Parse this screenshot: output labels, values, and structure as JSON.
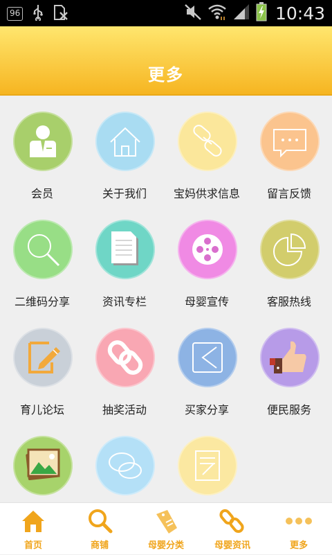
{
  "status_bar": {
    "badge": "96",
    "time": "10:43"
  },
  "header": {
    "title": "更多"
  },
  "grid": {
    "items": [
      {
        "label": "会员",
        "icon": "member-icon",
        "color": "#a8cf6b"
      },
      {
        "label": "关于我们",
        "icon": "home-icon",
        "color": "#a9dcf2"
      },
      {
        "label": "宝妈供求信息",
        "icon": "chain-link-icon",
        "color": "#fbe79b"
      },
      {
        "label": "留言反馈",
        "icon": "message-icon",
        "color": "#fbc48e"
      },
      {
        "label": "二维码分享",
        "icon": "magnifier-icon",
        "color": "#98de86"
      },
      {
        "label": "资讯专栏",
        "icon": "document-icon",
        "color": "#6fd6c6"
      },
      {
        "label": "母婴宣传",
        "icon": "film-reel-icon",
        "color": "#f08ae4"
      },
      {
        "label": "客服热线",
        "icon": "pie-chart-icon",
        "color": "#d2cd6c"
      },
      {
        "label": "育儿论坛",
        "icon": "edit-icon",
        "color": "#c9d0d8"
      },
      {
        "label": "抽奖活动",
        "icon": "link-icon",
        "color": "#f9a7b3"
      },
      {
        "label": "买家分享",
        "icon": "share-icon",
        "color": "#8db3e4"
      },
      {
        "label": "便民服务",
        "icon": "thumbs-up-icon",
        "color": "#b79be8"
      },
      {
        "label": "",
        "icon": "photo-icon",
        "color": "#a7d36b"
      },
      {
        "label": "",
        "icon": "chat-icon",
        "color": "#b4e0f7"
      },
      {
        "label": "",
        "icon": "notepad-icon",
        "color": "#fbe8a1"
      }
    ]
  },
  "tabbar": {
    "accent": "#f0a51c",
    "tabs": [
      {
        "label": "首页",
        "icon": "home-icon"
      },
      {
        "label": "商铺",
        "icon": "search-icon"
      },
      {
        "label": "母婴分类",
        "icon": "sale-tag-icon"
      },
      {
        "label": "母婴资讯",
        "icon": "link-icon"
      },
      {
        "label": "更多",
        "icon": "more-dots-icon"
      }
    ]
  }
}
